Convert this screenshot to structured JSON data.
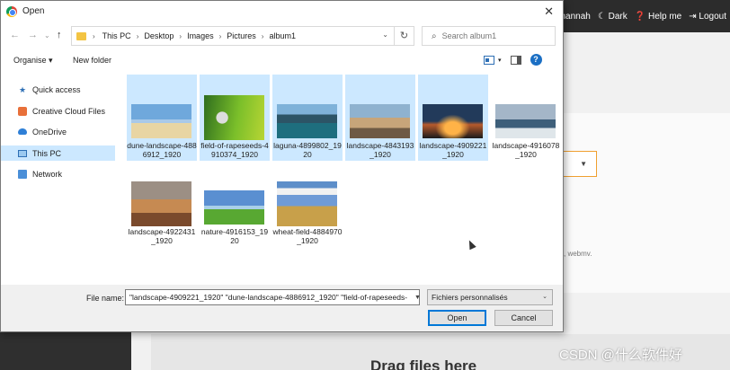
{
  "background": {
    "nav": {
      "user": "Johannah",
      "dark": "Dark",
      "help": "Help me",
      "logout": "Logout"
    },
    "hint_suffix": ", webmv.",
    "dropzone_text": "Drag files here",
    "watermark": "CSDN @什么软件好"
  },
  "dialog": {
    "title": "Open",
    "breadcrumb": [
      "This PC",
      "Desktop",
      "Images",
      "Pictures",
      "album1"
    ],
    "search_placeholder": "Search album1",
    "toolbar": {
      "organise": "Organise",
      "new_folder": "New folder"
    },
    "sidebar": [
      {
        "label": "Quick access",
        "icon": "star-icon"
      },
      {
        "label": "Creative Cloud Files",
        "icon": "creative-cloud-icon"
      },
      {
        "label": "OneDrive",
        "icon": "cloud-icon"
      },
      {
        "label": "This PC",
        "icon": "computer-icon",
        "selected": true
      },
      {
        "label": "Network",
        "icon": "network-icon"
      }
    ],
    "files": [
      {
        "name": "dune-landscape-4886912_1920",
        "selected": true
      },
      {
        "name": "field-of-rapeseeds-4910374_1920",
        "selected": true
      },
      {
        "name": "laguna-4899802_1920",
        "selected": true
      },
      {
        "name": "landscape-4843193_1920",
        "selected": true
      },
      {
        "name": "landscape-4909221_1920",
        "selected": true
      },
      {
        "name": "landscape-4916078_1920",
        "selected": false
      },
      {
        "name": "landscape-4922431_1920",
        "selected": false
      },
      {
        "name": "nature-4916153_1920",
        "selected": false
      },
      {
        "name": "wheat-field-4884970_1920",
        "selected": false
      }
    ],
    "file_name_label": "File name:",
    "file_name_value": "\"landscape-4909221_1920\" \"dune-landscape-4886912_1920\" \"field-of-rapeseeds-",
    "file_type": "Fichiers personnalisés",
    "open_label": "Open",
    "cancel_label": "Cancel"
  }
}
